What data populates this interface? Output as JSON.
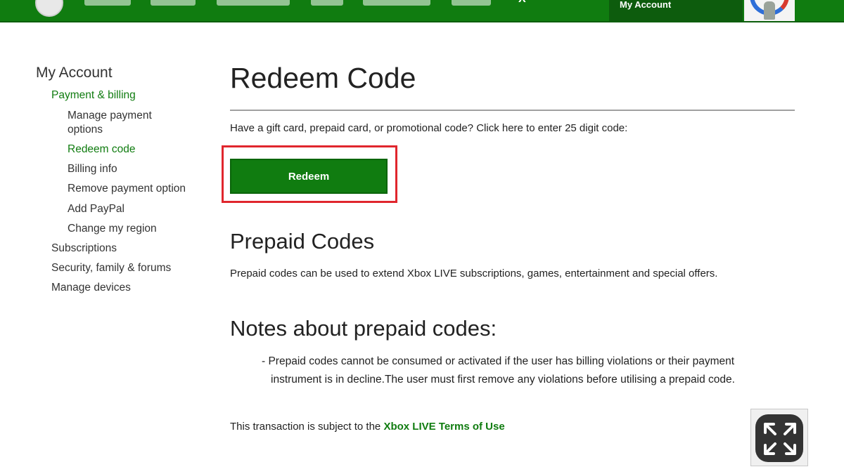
{
  "header": {
    "account_label": "My Account",
    "x_glyph": "X"
  },
  "sidebar": {
    "title": "My Account",
    "items": [
      {
        "label": "Payment & billing",
        "level": 1,
        "active": true
      },
      {
        "label": "Manage payment options",
        "level": 2,
        "active": false
      },
      {
        "label": "Redeem code",
        "level": 2,
        "active": true
      },
      {
        "label": "Billing info",
        "level": 2,
        "active": false
      },
      {
        "label": "Remove payment option",
        "level": 2,
        "active": false
      },
      {
        "label": "Add PayPal",
        "level": 2,
        "active": false
      },
      {
        "label": "Change my region",
        "level": 2,
        "active": false
      },
      {
        "label": "Subscriptions",
        "level": 1,
        "active": false
      },
      {
        "label": "Security, family & forums",
        "level": 1,
        "active": false
      },
      {
        "label": "Manage devices",
        "level": 1,
        "active": false
      }
    ]
  },
  "main": {
    "title": "Redeem Code",
    "intro": "Have a gift card, prepaid card, or promotional code? Click here to enter 25 digit code:",
    "redeem_label": "Redeem",
    "prepaid": {
      "heading": "Prepaid Codes",
      "text": "Prepaid codes can be used to extend Xbox LIVE subscriptions, games, entertainment and special offers."
    },
    "notes": {
      "heading": "Notes about prepaid codes:",
      "line1": "- Prepaid codes cannot be consumed or activated if the user has billing violations or their payment",
      "line2": "instrument is in decline.The user must first remove any violations before utilising a prepaid code."
    },
    "terms": {
      "prefix": "This transaction is subject to the ",
      "link": "Xbox LIVE Terms of Use"
    }
  },
  "icons": {
    "fullscreen": "expand-arrows-icon"
  },
  "colors": {
    "brand_green": "#107c10",
    "highlight_red": "#e0262d"
  }
}
